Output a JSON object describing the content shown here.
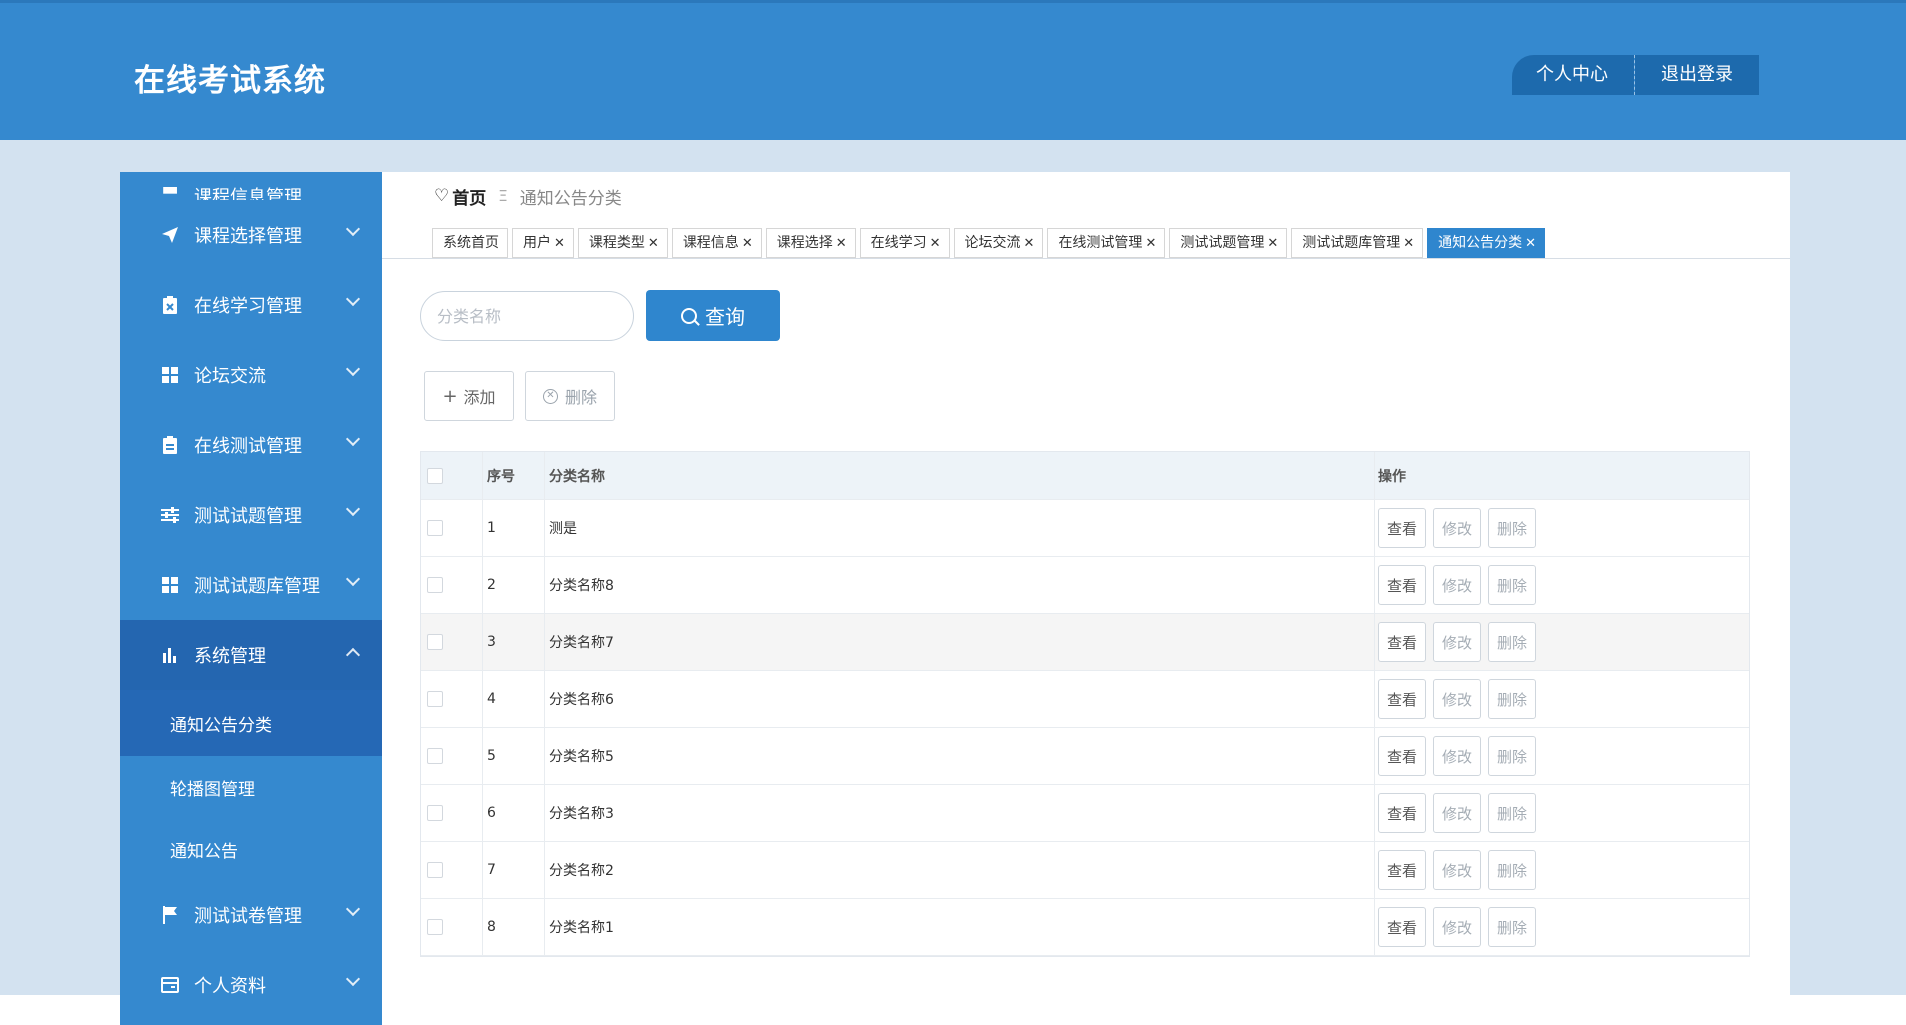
{
  "header": {
    "title": "在线考试系统",
    "profile_label": "个人中心",
    "logout_label": "退出登录"
  },
  "sidebar": {
    "items": [
      {
        "label": "课程信息管理",
        "icon": "table-icon"
      },
      {
        "label": "课程选择管理",
        "icon": "paper-plane-icon"
      },
      {
        "label": "在线学习管理",
        "icon": "clipboard-x-icon"
      },
      {
        "label": "论坛交流",
        "icon": "grid-icon"
      },
      {
        "label": "在线测试管理",
        "icon": "clipboard-icon"
      },
      {
        "label": "测试试题管理",
        "icon": "sliders-icon"
      },
      {
        "label": "测试试题库管理",
        "icon": "grid-icon"
      },
      {
        "label": "系统管理",
        "icon": "bar-chart-icon"
      },
      {
        "label": "测试试卷管理",
        "icon": "flag-icon"
      },
      {
        "label": "个人资料",
        "icon": "card-icon"
      }
    ],
    "sub_items": [
      "通知公告分类",
      "轮播图管理",
      "通知公告"
    ]
  },
  "breadcrumb": {
    "home": "首页",
    "separator": "Ξ",
    "current": "通知公告分类"
  },
  "tabs": [
    {
      "label": "系统首页",
      "closable": false
    },
    {
      "label": "用户",
      "closable": true
    },
    {
      "label": "课程类型",
      "closable": true
    },
    {
      "label": "课程信息",
      "closable": true
    },
    {
      "label": "课程选择",
      "closable": true
    },
    {
      "label": "在线学习",
      "closable": true
    },
    {
      "label": "论坛交流",
      "closable": true
    },
    {
      "label": "在线测试管理",
      "closable": true
    },
    {
      "label": "测试试题管理",
      "closable": true
    },
    {
      "label": "测试试题库管理",
      "closable": true
    },
    {
      "label": "通知公告分类",
      "closable": true,
      "active": true
    }
  ],
  "search": {
    "placeholder": "分类名称",
    "value": "",
    "button_label": "查询"
  },
  "toolbar": {
    "add_label": "添加",
    "delete_label": "删除"
  },
  "table": {
    "columns": [
      "序号",
      "分类名称",
      "操作"
    ],
    "actions": {
      "view": "查看",
      "edit": "修改",
      "delete": "删除"
    },
    "rows": [
      {
        "no": "1",
        "name": "测是"
      },
      {
        "no": "2",
        "name": "分类名称8"
      },
      {
        "no": "3",
        "name": "分类名称7"
      },
      {
        "no": "4",
        "name": "分类名称6"
      },
      {
        "no": "5",
        "name": "分类名称5"
      },
      {
        "no": "6",
        "name": "分类名称3"
      },
      {
        "no": "7",
        "name": "分类名称2"
      },
      {
        "no": "8",
        "name": "分类名称1"
      }
    ]
  },
  "colors": {
    "primary": "#3589cf",
    "primary_dark": "#2466b0",
    "page_bg": "#d3e2f0",
    "table_head_bg": "#edf3f8"
  }
}
